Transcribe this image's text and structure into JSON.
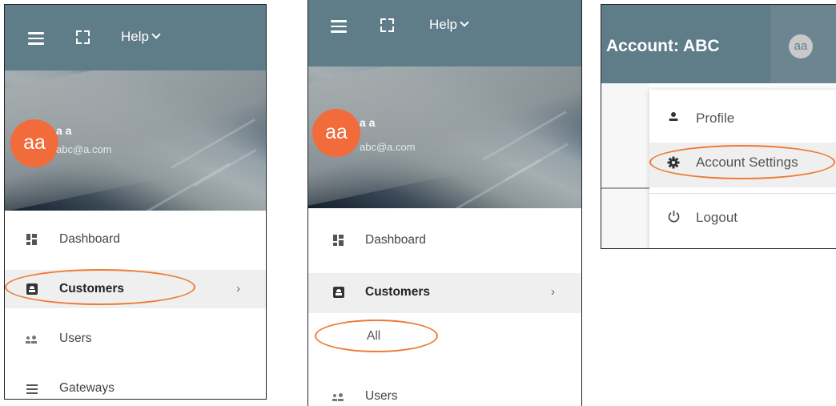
{
  "panel_1": {
    "help_label": "Help",
    "user": {
      "avatar_initials": "aa",
      "name": "a a",
      "email": "abc@a.com"
    },
    "menu": [
      {
        "label": "Dashboard",
        "icon": "dashboard-icon"
      },
      {
        "label": "Customers",
        "icon": "badge-icon",
        "expand_glyph": "›"
      },
      {
        "label": "Users",
        "icon": "users-icon"
      },
      {
        "label": "Gateways",
        "icon": "lines-icon"
      }
    ]
  },
  "panel_2": {
    "help_label": "Help",
    "user": {
      "avatar_initials": "aa",
      "name": "a a",
      "email": "abc@a.com"
    },
    "menu": [
      {
        "label": "Dashboard",
        "icon": "dashboard-icon"
      },
      {
        "label": "Customers",
        "icon": "badge-icon",
        "expand_glyph": "›"
      },
      {
        "label": "All"
      },
      {
        "label": "Users",
        "icon": "users-icon"
      }
    ]
  },
  "panel_3": {
    "account_title": "Account: ABC",
    "avatar_initials": "aa",
    "dropdown": [
      {
        "label": "Profile",
        "icon": "person-icon"
      },
      {
        "label": "Account Settings",
        "icon": "gear-icon"
      },
      {
        "label": "Logout",
        "icon": "power-icon"
      }
    ]
  },
  "colors": {
    "header_bg": "#5f7c89",
    "avatar_orange": "#f26b3a",
    "annotation_orange": "#ee7a34",
    "active_row_bg": "#efefef"
  }
}
